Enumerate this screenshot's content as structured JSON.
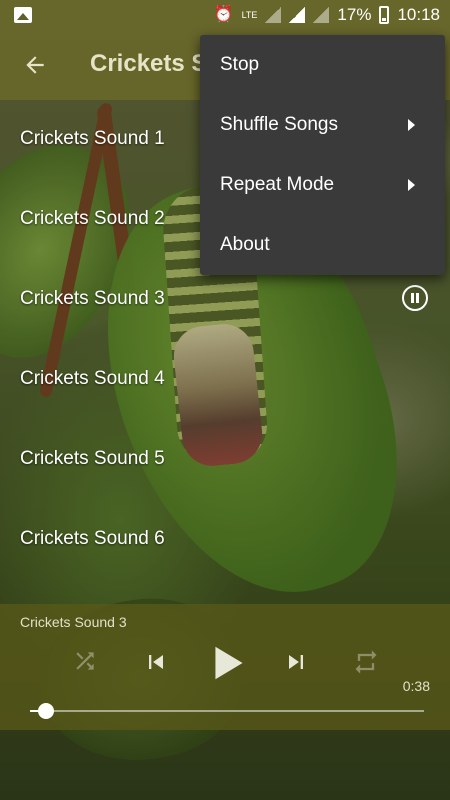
{
  "status_bar": {
    "battery": "17%",
    "time": "10:18",
    "network_label": "LTE"
  },
  "app_bar": {
    "title": "Crickets S"
  },
  "songs": [
    {
      "label": "Crickets Sound 1"
    },
    {
      "label": "Crickets Sound 2"
    },
    {
      "label": "Crickets Sound 3",
      "playing": true
    },
    {
      "label": "Crickets Sound 4"
    },
    {
      "label": "Crickets Sound 5"
    },
    {
      "label": "Crickets Sound 6"
    }
  ],
  "menu": {
    "items": [
      {
        "label": "Stop",
        "submenu": false
      },
      {
        "label": "Shuffle Songs",
        "submenu": true
      },
      {
        "label": "Repeat Mode",
        "submenu": true
      },
      {
        "label": "About",
        "submenu": false
      }
    ]
  },
  "player": {
    "now_playing": "Crickets Sound 3",
    "elapsed": "0:38",
    "progress": 0.04
  },
  "icons": {
    "back": "arrow-left",
    "pause": "pause-circle",
    "shuffle": "shuffle",
    "previous": "skip-previous",
    "play": "play",
    "next": "skip-next",
    "repeat": "repeat",
    "submenu": "chevron-right"
  },
  "colors": {
    "app_bar": "#69682a",
    "menu_bg": "#3a3a3a",
    "player_bg": "#585818"
  }
}
